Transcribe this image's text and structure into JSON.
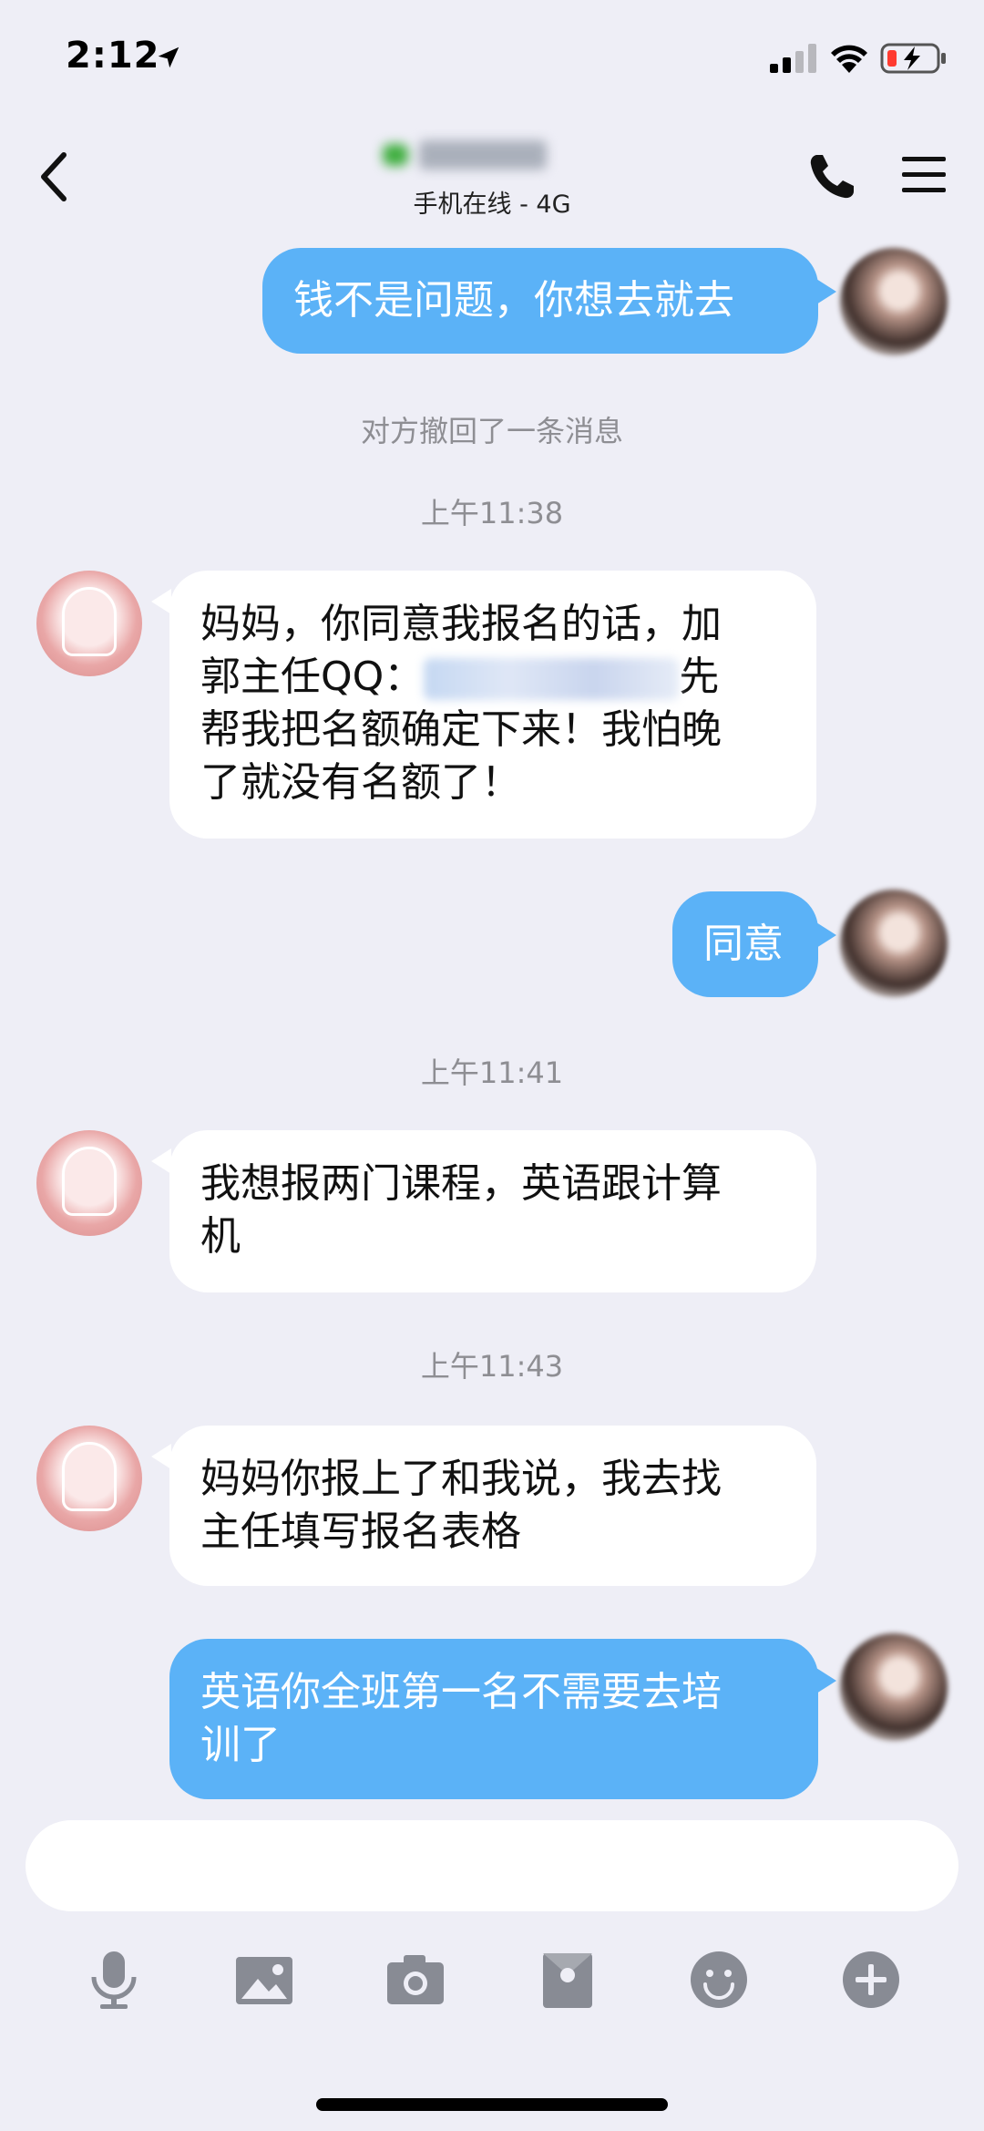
{
  "status_bar": {
    "time": "2:12"
  },
  "header": {
    "subtitle": "手机在线 - 4G"
  },
  "messages": [
    {
      "direction": "out",
      "text": "钱不是问题，你想去就去"
    },
    {
      "type": "system",
      "text": "对方撤回了一条消息"
    },
    {
      "type": "time",
      "text": "上午11:38"
    },
    {
      "direction": "in",
      "text_before": "妈妈，你同意我报名的话，加",
      "line2_prefix": "郭主任QQ：",
      "line2_suffix": "先",
      "line3": "帮我把名额确定下来！我怕晚",
      "line4": "了就没有名额了！"
    },
    {
      "direction": "out",
      "text": "同意"
    },
    {
      "type": "time",
      "text": "上午11:41"
    },
    {
      "direction": "in",
      "line1": "我想报两门课程，英语跟计算",
      "line2": "机"
    },
    {
      "type": "time",
      "text": "上午11:43"
    },
    {
      "direction": "in",
      "line1": "妈妈你报上了和我说，我去找",
      "line2": "主任填写报名表格"
    },
    {
      "direction": "out",
      "line1": "英语你全班第一名不需要去培",
      "line2": "训了"
    }
  ],
  "input": {
    "placeholder": ""
  },
  "toolbar_icons": [
    "microphone-icon",
    "image-icon",
    "camera-icon",
    "red-packet-icon",
    "emoji-icon",
    "plus-icon"
  ],
  "colors": {
    "background": "#eeeef6",
    "outgoing_bubble": "#5bb2f7",
    "incoming_bubble": "#ffffff",
    "system_text": "#8e8e93"
  }
}
